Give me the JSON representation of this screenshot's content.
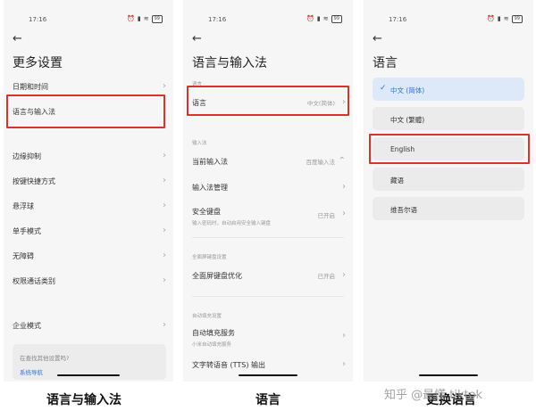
{
  "status": {
    "time": "17:16",
    "battery": "99"
  },
  "panel1": {
    "title": "更多设置",
    "items": [
      {
        "label": "日期和时间"
      },
      {
        "label": "语言与输入法"
      },
      {
        "label": "边缘抑制"
      },
      {
        "label": "按键快捷方式"
      },
      {
        "label": "悬浮球"
      },
      {
        "label": "单手模式"
      },
      {
        "label": "无障碍"
      },
      {
        "label": "权限通话类别"
      },
      {
        "label": "企业模式"
      }
    ],
    "footer": "在查找其他设置吗?",
    "footer_link": "系统导航"
  },
  "panel2": {
    "title": "语言与输入法",
    "section_lang": "语言",
    "language": {
      "label": "语言",
      "value": "中文(简体)"
    },
    "section_input": "输入法",
    "current_ime": {
      "label": "当前输入法",
      "value": "百度输入法"
    },
    "ime_manage": {
      "label": "输入法管理"
    },
    "secure_kb": {
      "label": "安全键盘",
      "sub": "输入密码时，自动启用安全输入键盘",
      "value": "已开启"
    },
    "section_fullscreen": "全面屏键盘设置",
    "fullscreen_opt": {
      "label": "全面屏键盘优化",
      "value": "已开启"
    },
    "section_voice": "自动填充设置",
    "autofill": {
      "label": "自动填充服务",
      "sub": "小米自动填充服务"
    },
    "tts": {
      "label": "文字转语音 (TTS) 输出"
    }
  },
  "panel3": {
    "title": "语言",
    "languages": [
      {
        "label": "中文 (简体)",
        "selected": true
      },
      {
        "label": "中文 (繁體)"
      },
      {
        "label": "English"
      },
      {
        "label": "藏语"
      },
      {
        "label": "维吾尔语"
      }
    ]
  },
  "captions": {
    "c1": "语言与输入法",
    "c2": "语言",
    "c3": "更换语言"
  },
  "watermark": "知乎 @最懂 tiktok",
  "colors": {
    "highlight": "#d9342b",
    "accent": "#2f75d6"
  }
}
